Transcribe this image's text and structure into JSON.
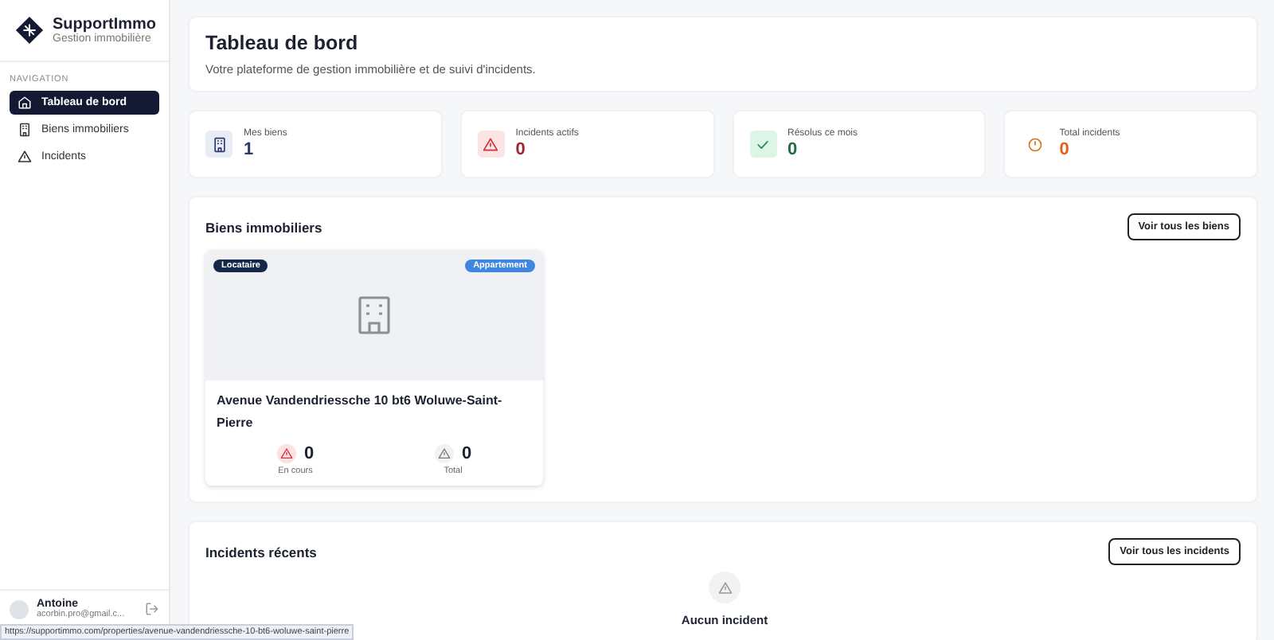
{
  "sidebar": {
    "brand": {
      "name": "SupportImmo",
      "tagline": "Gestion immobilière"
    },
    "section_label": "NAVIGATION",
    "items": [
      {
        "label": "Tableau de bord",
        "kind": "home",
        "selected": true
      },
      {
        "label": "Biens immobiliers",
        "kind": "building",
        "selected": false
      },
      {
        "label": "Incidents",
        "kind": "warning",
        "selected": false
      }
    ],
    "user": {
      "name": "Antoine",
      "email": "acorbin.pro@gmail.c..."
    }
  },
  "header": {
    "title": "Tableau de bord",
    "subtitle": "Votre plateforme de gestion immobilière et de suivi d'incidents."
  },
  "stats": [
    {
      "label": "Mes biens",
      "value": "1",
      "kind": "building"
    },
    {
      "label": "Incidents actifs",
      "value": "0",
      "kind": "warning"
    },
    {
      "label": "Résolus ce mois",
      "value": "0",
      "kind": "check"
    },
    {
      "label": "Total incidents",
      "value": "0",
      "kind": "clock"
    }
  ],
  "properties": {
    "title": "Biens immobiliers",
    "button": "Voir tous les biens",
    "cards": [
      {
        "tenant_badge": "Locataire",
        "type_badge": "Appartement",
        "address": "Avenue Vandendriessche 10 bt6 Woluwe-Saint-Pierre",
        "counts": [
          {
            "kind": "active",
            "value": "0",
            "label": "En cours"
          },
          {
            "kind": "total",
            "value": "0",
            "label": "Total"
          }
        ]
      }
    ]
  },
  "incidents": {
    "title": "Incidents récents",
    "button": "Voir tous les incidents",
    "empty_title": "Aucun incident"
  },
  "status_bar": {
    "url": "https://supportimmo.com/properties/avenue-vandendriessche-10-bt6-woluwe-saint-pierre"
  }
}
